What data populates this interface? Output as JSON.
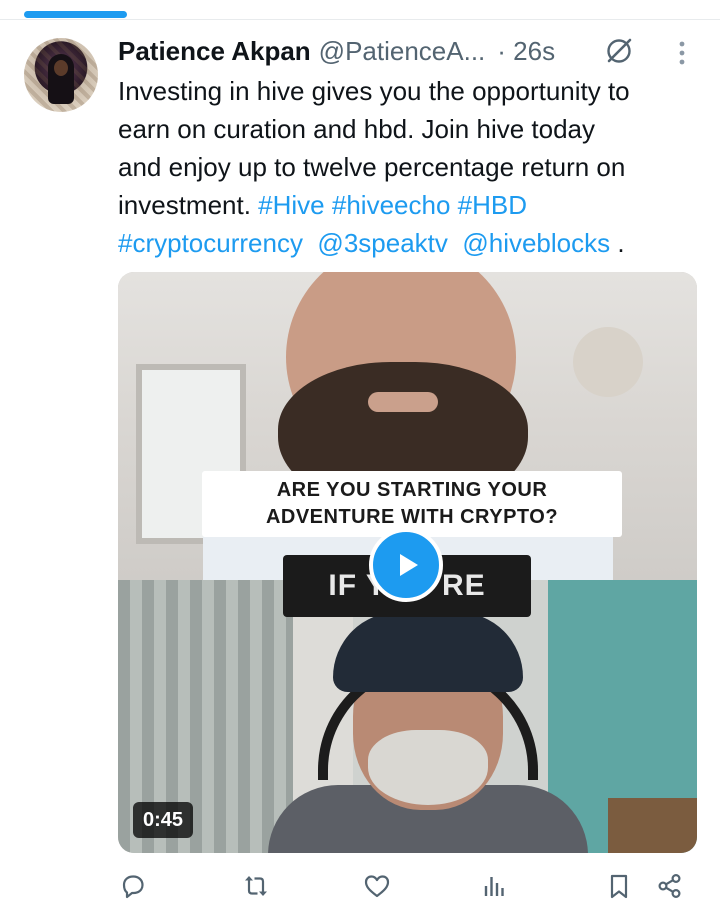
{
  "tweet": {
    "display_name": "Patience Akpan",
    "handle": "@PatienceA...",
    "time": "· 26s",
    "lines": [
      "Investing in hive gives you the opportunity to",
      "earn on curation and hbd. Join hive today",
      "and enjoy up to twelve percentage return on"
    ],
    "line4_text": "investment. ",
    "hashtags": [
      "#Hive",
      "#hiveecho",
      "#HBD",
      "#cryptocurrency"
    ],
    "mentions": [
      "@3speaktv",
      "@hiveblocks"
    ],
    "trailing": "."
  },
  "video": {
    "caption_line1": "ARE YOU STARTING YOUR",
    "caption_line2": "ADVENTURE WITH CRYPTO?",
    "subtitle": "IF YOU'RE",
    "duration": "0:45",
    "progress": 0.14
  },
  "icons": {
    "grok": "grok-icon",
    "more": "more-vertical-icon",
    "reply": "reply-icon",
    "repost": "repost-icon",
    "like": "heart-icon",
    "views": "analytics-icon",
    "bookmark": "bookmark-icon",
    "share": "share-icon"
  },
  "colors": {
    "accent": "#1d9bf0",
    "text": "#0f1419",
    "muted": "#536471"
  }
}
